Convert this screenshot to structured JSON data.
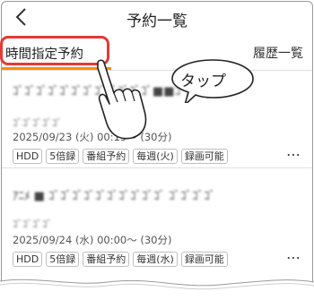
{
  "header": {
    "back_icon": "chevron-left-icon",
    "title": "予約一覧"
  },
  "tabs": {
    "left": "時間指定予約",
    "right": "履歴一覧",
    "accent": "#ff8c00"
  },
  "annotation": {
    "bubble": "タップ",
    "highlight_color": "#e53935"
  },
  "items": [
    {
      "title_blurred": "ｺﾞｺﾞｺﾞｺﾞｺﾞｺﾞｺﾞｺﾞｺﾞｺﾞｺﾞｺﾞ■■ｺﾞｺﾞｺﾞｺﾞ",
      "sub_blurred": "ｺﾞｺﾞｺﾞｺﾞｺﾞ",
      "datetime": "2025/09/23 (火) 00:15～ (30分)",
      "tags": [
        "HDD",
        "5倍録",
        "番組予約",
        "毎週(火)",
        "録画可能"
      ]
    },
    {
      "title_blurred": "ｱﾆﾒ ■ ｺﾞｺﾞｺﾞｺﾞｺﾞｺﾞｺﾞｺﾞｺﾞｺﾞ ｺﾞｺﾞｺﾞｺﾞ",
      "sub_blurred": "ｺﾞｺﾞｺﾞｺﾞ",
      "datetime": "2025/09/24 (水) 00:00～ (30分)",
      "tags": [
        "HDD",
        "5倍録",
        "番組予約",
        "毎週(水)",
        "録画可能"
      ]
    }
  ]
}
